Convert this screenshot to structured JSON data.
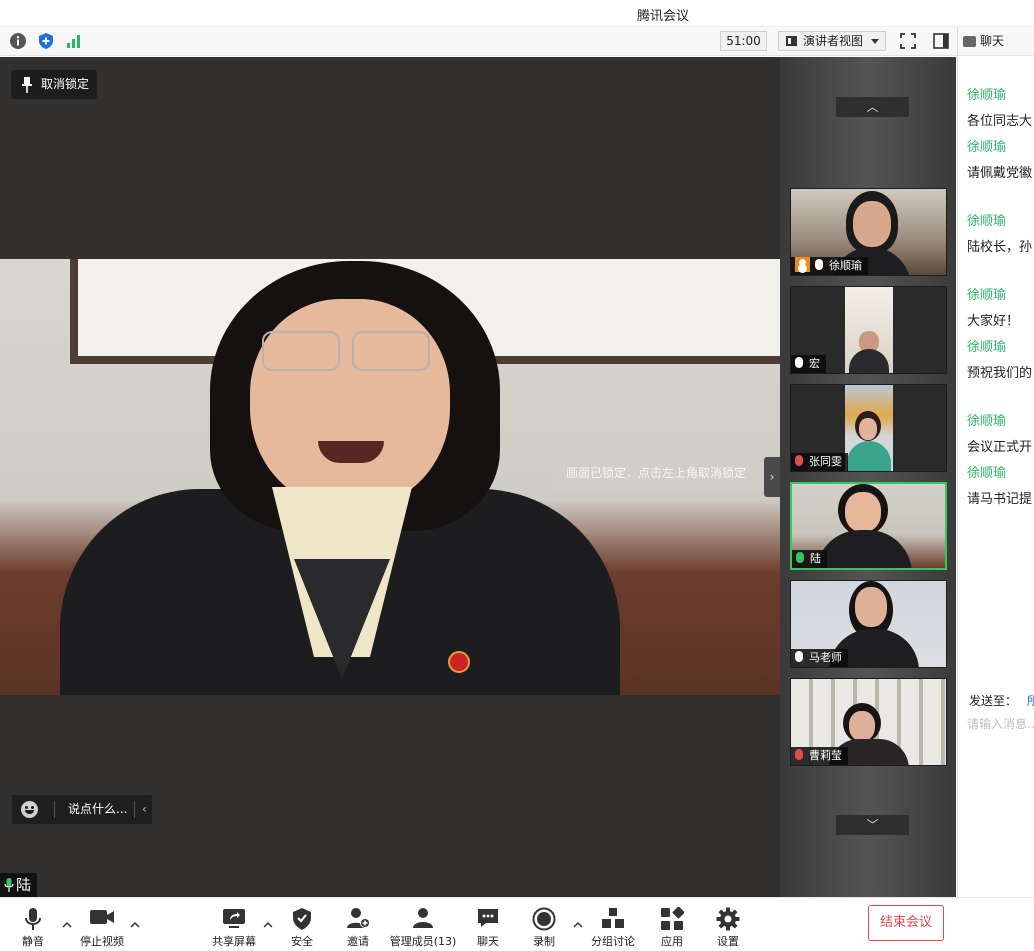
{
  "window": {
    "title": "腾讯会议"
  },
  "toolbar": {
    "timer": "51:00",
    "view_mode": "演讲者视图"
  },
  "stage": {
    "unlock_label": "取消锁定",
    "lock_toast": "画面已锁定，点击左上角取消锁定",
    "say_placeholder": "说点什么...",
    "active_speaker": "陆"
  },
  "participants": [
    {
      "name": "徐顺瑜",
      "host": true,
      "muted": false,
      "active": false
    },
    {
      "name": "宏",
      "host": false,
      "muted": false,
      "active": false
    },
    {
      "name": "张同雯",
      "host": false,
      "muted": true,
      "active": false
    },
    {
      "name": "陆",
      "host": false,
      "muted": false,
      "active": true
    },
    {
      "name": "马老师",
      "host": false,
      "muted": false,
      "active": false
    },
    {
      "name": "曹莉莹",
      "host": false,
      "muted": true,
      "active": false
    }
  ],
  "chat": {
    "title": "聊天",
    "messages": [
      {
        "sender": "徐顺瑜",
        "text": "各位同志大"
      },
      {
        "sender": "徐顺瑜",
        "text": "请佩戴党徽"
      },
      {
        "sender": "徐顺瑜",
        "text": "陆校长，孙"
      },
      {
        "sender": "徐顺瑜",
        "text": "大家好！"
      },
      {
        "sender": "徐顺瑜",
        "text": "预祝我们的"
      },
      {
        "sender": "徐顺瑜",
        "text": "会议正式开"
      },
      {
        "sender": "徐顺瑜",
        "text": "请马书记提"
      }
    ],
    "send_to_label": "发送至：",
    "send_to_target": "所",
    "input_placeholder": "请输入消息..."
  },
  "bottombar": {
    "mute": "静音",
    "stop_video": "停止视频",
    "share_screen": "共享屏幕",
    "security": "安全",
    "invite": "邀请",
    "manage_members": "管理成员(13)",
    "chat": "聊天",
    "record": "录制",
    "breakout": "分组讨论",
    "apps": "应用",
    "settings": "设置",
    "end_meeting": "结束会议"
  },
  "colors": {
    "accent_green": "#34c759",
    "chat_sender": "#2fb36b",
    "end_red": "#e04b4b",
    "host_orange": "#f08a1c"
  }
}
